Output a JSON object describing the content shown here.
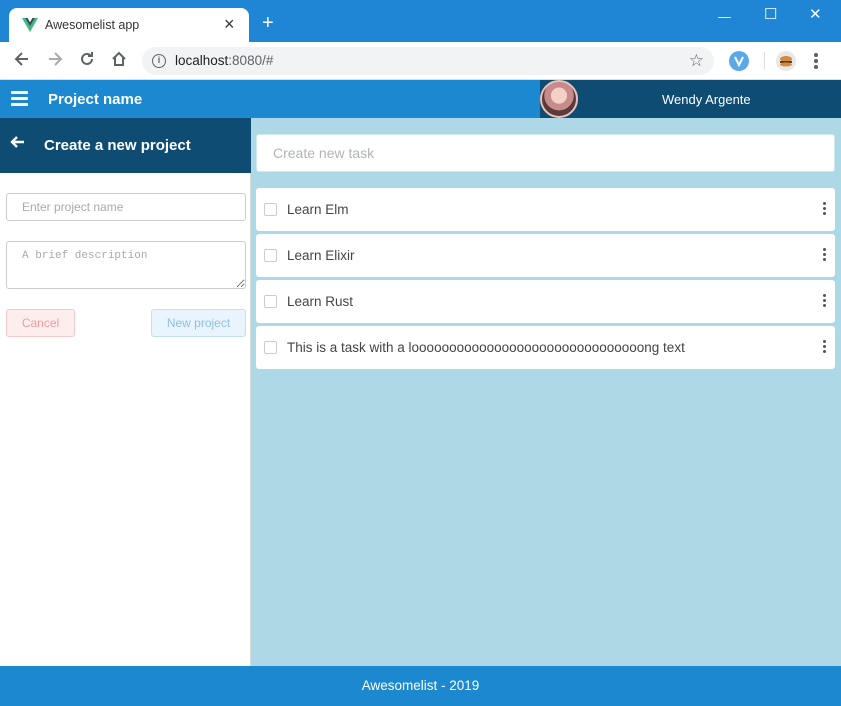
{
  "browser": {
    "tab_title": "Awesomelist app",
    "tab_close": "×",
    "new_tab": "+",
    "url_host": "localhost",
    "url_rest": ":8080/#",
    "window_controls": {
      "minimize": "—",
      "maximize": "☐",
      "close": "✕"
    },
    "icons": {
      "back": "back-arrow-icon",
      "forward": "forward-arrow-icon",
      "reload": "reload-icon",
      "home": "home-icon",
      "info": "info-icon",
      "bookmark": "star-icon",
      "menu": "kebab-menu-icon"
    }
  },
  "header": {
    "project_name": "Project name",
    "user_name": "Wendy Argente"
  },
  "sidebar": {
    "title": "Create a new project",
    "project_name_placeholder": "Enter project name",
    "description_placeholder": "A brief description",
    "cancel_label": "Cancel",
    "new_project_label": "New project"
  },
  "main": {
    "task_input_placeholder": "Create new task",
    "tasks": [
      {
        "label": "Learn Elm"
      },
      {
        "label": "Learn Elixir"
      },
      {
        "label": "Learn Rust"
      },
      {
        "label": "This is a task with a looooooooooooooooooooooooooooooong text"
      }
    ]
  },
  "footer": {
    "text": "Awesomelist - 2019"
  },
  "colors": {
    "app_bar": "#1b88cf",
    "dark_blue": "#0f4c73",
    "main_bg": "#add8e6"
  }
}
